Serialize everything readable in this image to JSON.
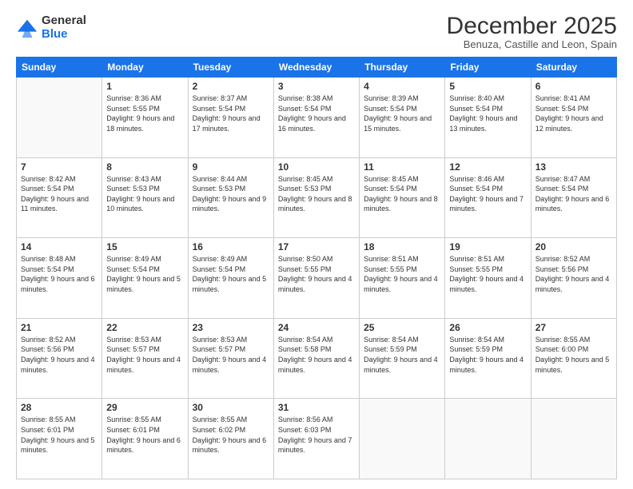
{
  "logo": {
    "general": "General",
    "blue": "Blue"
  },
  "title": "December 2025",
  "subtitle": "Benuza, Castille and Leon, Spain",
  "days_of_week": [
    "Sunday",
    "Monday",
    "Tuesday",
    "Wednesday",
    "Thursday",
    "Friday",
    "Saturday"
  ],
  "weeks": [
    [
      {
        "day": "",
        "data": null
      },
      {
        "day": "1",
        "data": {
          "sunrise": "Sunrise: 8:36 AM",
          "sunset": "Sunset: 5:55 PM",
          "daylight": "Daylight: 9 hours and 18 minutes."
        }
      },
      {
        "day": "2",
        "data": {
          "sunrise": "Sunrise: 8:37 AM",
          "sunset": "Sunset: 5:54 PM",
          "daylight": "Daylight: 9 hours and 17 minutes."
        }
      },
      {
        "day": "3",
        "data": {
          "sunrise": "Sunrise: 8:38 AM",
          "sunset": "Sunset: 5:54 PM",
          "daylight": "Daylight: 9 hours and 16 minutes."
        }
      },
      {
        "day": "4",
        "data": {
          "sunrise": "Sunrise: 8:39 AM",
          "sunset": "Sunset: 5:54 PM",
          "daylight": "Daylight: 9 hours and 15 minutes."
        }
      },
      {
        "day": "5",
        "data": {
          "sunrise": "Sunrise: 8:40 AM",
          "sunset": "Sunset: 5:54 PM",
          "daylight": "Daylight: 9 hours and 13 minutes."
        }
      },
      {
        "day": "6",
        "data": {
          "sunrise": "Sunrise: 8:41 AM",
          "sunset": "Sunset: 5:54 PM",
          "daylight": "Daylight: 9 hours and 12 minutes."
        }
      }
    ],
    [
      {
        "day": "7",
        "data": {
          "sunrise": "Sunrise: 8:42 AM",
          "sunset": "Sunset: 5:54 PM",
          "daylight": "Daylight: 9 hours and 11 minutes."
        }
      },
      {
        "day": "8",
        "data": {
          "sunrise": "Sunrise: 8:43 AM",
          "sunset": "Sunset: 5:53 PM",
          "daylight": "Daylight: 9 hours and 10 minutes."
        }
      },
      {
        "day": "9",
        "data": {
          "sunrise": "Sunrise: 8:44 AM",
          "sunset": "Sunset: 5:53 PM",
          "daylight": "Daylight: 9 hours and 9 minutes."
        }
      },
      {
        "day": "10",
        "data": {
          "sunrise": "Sunrise: 8:45 AM",
          "sunset": "Sunset: 5:53 PM",
          "daylight": "Daylight: 9 hours and 8 minutes."
        }
      },
      {
        "day": "11",
        "data": {
          "sunrise": "Sunrise: 8:45 AM",
          "sunset": "Sunset: 5:54 PM",
          "daylight": "Daylight: 9 hours and 8 minutes."
        }
      },
      {
        "day": "12",
        "data": {
          "sunrise": "Sunrise: 8:46 AM",
          "sunset": "Sunset: 5:54 PM",
          "daylight": "Daylight: 9 hours and 7 minutes."
        }
      },
      {
        "day": "13",
        "data": {
          "sunrise": "Sunrise: 8:47 AM",
          "sunset": "Sunset: 5:54 PM",
          "daylight": "Daylight: 9 hours and 6 minutes."
        }
      }
    ],
    [
      {
        "day": "14",
        "data": {
          "sunrise": "Sunrise: 8:48 AM",
          "sunset": "Sunset: 5:54 PM",
          "daylight": "Daylight: 9 hours and 6 minutes."
        }
      },
      {
        "day": "15",
        "data": {
          "sunrise": "Sunrise: 8:49 AM",
          "sunset": "Sunset: 5:54 PM",
          "daylight": "Daylight: 9 hours and 5 minutes."
        }
      },
      {
        "day": "16",
        "data": {
          "sunrise": "Sunrise: 8:49 AM",
          "sunset": "Sunset: 5:54 PM",
          "daylight": "Daylight: 9 hours and 5 minutes."
        }
      },
      {
        "day": "17",
        "data": {
          "sunrise": "Sunrise: 8:50 AM",
          "sunset": "Sunset: 5:55 PM",
          "daylight": "Daylight: 9 hours and 4 minutes."
        }
      },
      {
        "day": "18",
        "data": {
          "sunrise": "Sunrise: 8:51 AM",
          "sunset": "Sunset: 5:55 PM",
          "daylight": "Daylight: 9 hours and 4 minutes."
        }
      },
      {
        "day": "19",
        "data": {
          "sunrise": "Sunrise: 8:51 AM",
          "sunset": "Sunset: 5:55 PM",
          "daylight": "Daylight: 9 hours and 4 minutes."
        }
      },
      {
        "day": "20",
        "data": {
          "sunrise": "Sunrise: 8:52 AM",
          "sunset": "Sunset: 5:56 PM",
          "daylight": "Daylight: 9 hours and 4 minutes."
        }
      }
    ],
    [
      {
        "day": "21",
        "data": {
          "sunrise": "Sunrise: 8:52 AM",
          "sunset": "Sunset: 5:56 PM",
          "daylight": "Daylight: 9 hours and 4 minutes."
        }
      },
      {
        "day": "22",
        "data": {
          "sunrise": "Sunrise: 8:53 AM",
          "sunset": "Sunset: 5:57 PM",
          "daylight": "Daylight: 9 hours and 4 minutes."
        }
      },
      {
        "day": "23",
        "data": {
          "sunrise": "Sunrise: 8:53 AM",
          "sunset": "Sunset: 5:57 PM",
          "daylight": "Daylight: 9 hours and 4 minutes."
        }
      },
      {
        "day": "24",
        "data": {
          "sunrise": "Sunrise: 8:54 AM",
          "sunset": "Sunset: 5:58 PM",
          "daylight": "Daylight: 9 hours and 4 minutes."
        }
      },
      {
        "day": "25",
        "data": {
          "sunrise": "Sunrise: 8:54 AM",
          "sunset": "Sunset: 5:59 PM",
          "daylight": "Daylight: 9 hours and 4 minutes."
        }
      },
      {
        "day": "26",
        "data": {
          "sunrise": "Sunrise: 8:54 AM",
          "sunset": "Sunset: 5:59 PM",
          "daylight": "Daylight: 9 hours and 4 minutes."
        }
      },
      {
        "day": "27",
        "data": {
          "sunrise": "Sunrise: 8:55 AM",
          "sunset": "Sunset: 6:00 PM",
          "daylight": "Daylight: 9 hours and 5 minutes."
        }
      }
    ],
    [
      {
        "day": "28",
        "data": {
          "sunrise": "Sunrise: 8:55 AM",
          "sunset": "Sunset: 6:01 PM",
          "daylight": "Daylight: 9 hours and 5 minutes."
        }
      },
      {
        "day": "29",
        "data": {
          "sunrise": "Sunrise: 8:55 AM",
          "sunset": "Sunset: 6:01 PM",
          "daylight": "Daylight: 9 hours and 6 minutes."
        }
      },
      {
        "day": "30",
        "data": {
          "sunrise": "Sunrise: 8:55 AM",
          "sunset": "Sunset: 6:02 PM",
          "daylight": "Daylight: 9 hours and 6 minutes."
        }
      },
      {
        "day": "31",
        "data": {
          "sunrise": "Sunrise: 8:56 AM",
          "sunset": "Sunset: 6:03 PM",
          "daylight": "Daylight: 9 hours and 7 minutes."
        }
      },
      {
        "day": "",
        "data": null
      },
      {
        "day": "",
        "data": null
      },
      {
        "day": "",
        "data": null
      }
    ]
  ],
  "accent_color": "#1a73e8"
}
